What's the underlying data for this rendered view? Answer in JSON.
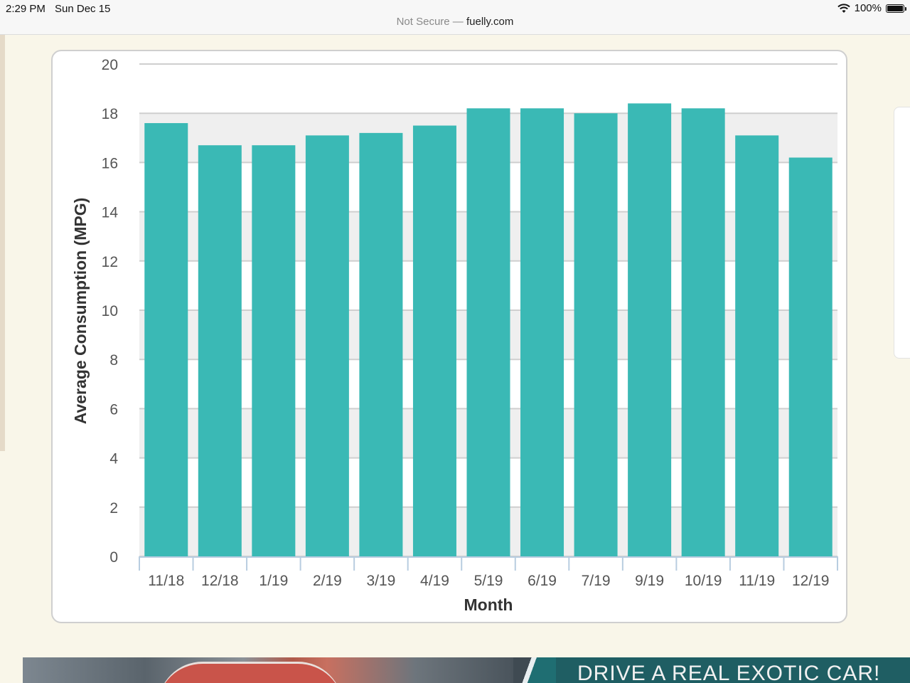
{
  "status_bar": {
    "time": "2:29 PM",
    "date": "Sun Dec 15",
    "battery": "100%"
  },
  "url_bar": {
    "insecure_label": "Not Secure —",
    "domain": "fuelly.com"
  },
  "colors": {
    "bar": "#3ab9b5",
    "band": "#efefef",
    "grid": "#cfcfcf"
  },
  "chart_data": {
    "type": "bar",
    "categories": [
      "11/18",
      "12/18",
      "1/19",
      "2/19",
      "3/19",
      "4/19",
      "5/19",
      "6/19",
      "7/19",
      "9/19",
      "10/19",
      "11/19",
      "12/19"
    ],
    "values": [
      17.6,
      16.7,
      16.7,
      17.1,
      17.2,
      17.5,
      18.2,
      18.2,
      18.0,
      18.4,
      18.2,
      17.1,
      16.2
    ],
    "xlabel": "Month",
    "ylabel": "Average Consumption (MPG)",
    "ylim": [
      0,
      20
    ],
    "yticks": [
      0,
      2,
      4,
      6,
      8,
      10,
      12,
      14,
      16,
      18,
      20
    ],
    "grid": true,
    "legend": "none"
  },
  "ad": {
    "text": "DRIVE A REAL EXOTIC CAR!"
  }
}
